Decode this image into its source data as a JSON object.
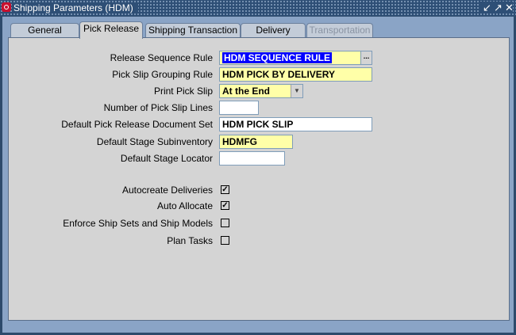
{
  "window": {
    "title": "Shipping Parameters (HDM)",
    "buttons": [
      "↙",
      "↗",
      "✕"
    ]
  },
  "tabs": [
    {
      "label": "General",
      "active": false,
      "disabled": false
    },
    {
      "label": "Pick Release",
      "active": true,
      "disabled": false
    },
    {
      "label": "Shipping Transaction",
      "active": false,
      "disabled": false
    },
    {
      "label": "Delivery",
      "active": false,
      "disabled": false
    },
    {
      "label": "Transportation",
      "active": false,
      "disabled": true
    }
  ],
  "form": {
    "release_sequence_rule": {
      "label": "Release Sequence Rule",
      "value": "HDM SEQUENCE RULE",
      "lov": "..."
    },
    "pick_slip_grouping_rule": {
      "label": "Pick Slip Grouping Rule",
      "value": "HDM PICK BY DELIVERY"
    },
    "print_pick_slip": {
      "label": "Print Pick Slip",
      "value": "At the End"
    },
    "number_of_pick_slip_lines": {
      "label": "Number of Pick Slip Lines",
      "value": ""
    },
    "default_pick_release_document_set": {
      "label": "Default Pick Release Document Set",
      "value": "HDM PICK SLIP"
    },
    "default_stage_subinventory": {
      "label": "Default Stage Subinventory",
      "value": "HDMFG"
    },
    "default_stage_locator": {
      "label": "Default Stage Locator",
      "value": ""
    }
  },
  "checkboxes": [
    {
      "label": "Autocreate Deliveries",
      "checked": true
    },
    {
      "label": "Auto Allocate",
      "checked": true
    },
    {
      "label": "Enforce Ship Sets and Ship Models",
      "checked": false
    },
    {
      "label": "Plan Tasks",
      "checked": false
    }
  ],
  "colors": {
    "titlebar": "#2e4f76",
    "frame": "#8aa4c6",
    "panel": "#d4d4d4",
    "required_field": "#ffffa8",
    "selection": "#0000ff"
  }
}
